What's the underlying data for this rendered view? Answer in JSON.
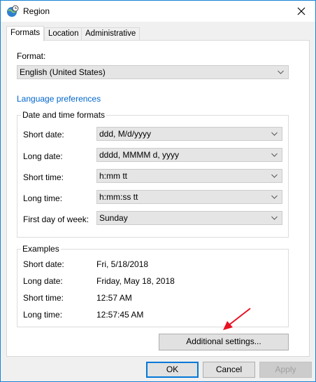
{
  "window": {
    "title": "Region",
    "title_icon": "globe-clock-icon",
    "close_icon": "close-icon"
  },
  "tabs": [
    {
      "label": "Formats",
      "active": true
    },
    {
      "label": "Location",
      "active": false
    },
    {
      "label": "Administrative",
      "active": false
    }
  ],
  "format": {
    "label": "Format:",
    "value": "English (United States)"
  },
  "language_link": "Language preferences",
  "date_time_formats": {
    "title": "Date and time formats",
    "rows": [
      {
        "label": "Short date:",
        "value": "ddd, M/d/yyyy"
      },
      {
        "label": "Long date:",
        "value": "dddd, MMMM d, yyyy"
      },
      {
        "label": "Short time:",
        "value": "h:mm tt"
      },
      {
        "label": "Long time:",
        "value": "h:mm:ss tt"
      },
      {
        "label": "First day of week:",
        "value": "Sunday"
      }
    ]
  },
  "examples": {
    "title": "Examples",
    "rows": [
      {
        "label": "Short date:",
        "value": "Fri, 5/18/2018"
      },
      {
        "label": "Long date:",
        "value": "Friday, May 18, 2018"
      },
      {
        "label": "Short time:",
        "value": "12:57 AM"
      },
      {
        "label": "Long time:",
        "value": "12:57:45 AM"
      }
    ]
  },
  "additional_settings": "Additional settings...",
  "buttons": {
    "ok": "OK",
    "cancel": "Cancel",
    "apply": "Apply"
  },
  "colors": {
    "accent": "#0078d7",
    "link": "#0066cc",
    "annotation_arrow": "#e81123"
  }
}
